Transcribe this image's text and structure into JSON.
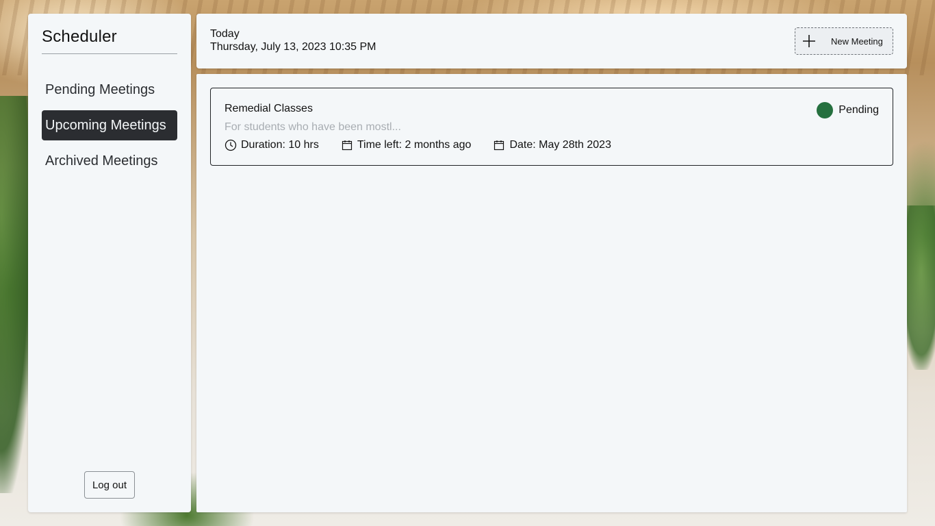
{
  "sidebar": {
    "title": "Scheduler",
    "items": [
      {
        "label": "Pending Meetings"
      },
      {
        "label": "Upcoming Meetings"
      },
      {
        "label": "Archived Meetings"
      }
    ],
    "active_item": "Upcoming Meetings",
    "logout_label": "Log out"
  },
  "header": {
    "today_label": "Today",
    "datetime": "Thursday, July 13, 2023 10:35 PM",
    "new_meeting_label": "New Meeting",
    "new_meeting_icon": "plus-icon"
  },
  "meetings": [
    {
      "title": "Remedial Classes",
      "description": "For students who have been mostl...",
      "duration": "Duration: 10 hrs",
      "time_left": "Time left: 2 months ago",
      "date": "Date: May 28th 2023",
      "status": "Pending",
      "status_color": "#25703f",
      "icons": {
        "duration": "clock-icon",
        "time_left": "calendar-icon",
        "date": "calendar-icon"
      }
    }
  ],
  "colors": {
    "active_nav_bg": "#2b2d31",
    "panel_bg": "#f4f7f9",
    "muted_text": "#a8adb2"
  }
}
